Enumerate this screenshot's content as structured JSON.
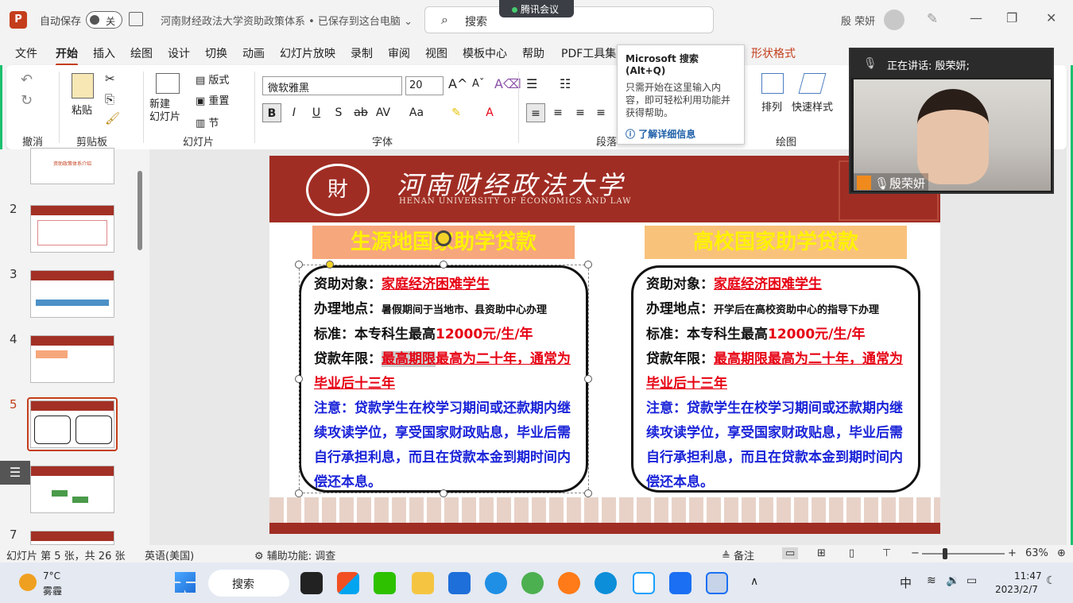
{
  "titlebar": {
    "autosave_label": "自动保存",
    "autosave_state": "关",
    "doc_title": "河南财经政法大学资助政策体系 • 已保存到这台电脑 ⌄",
    "search_label": "搜索",
    "meeting_pill": "腾讯会议",
    "user_name": "殷 荣妍"
  },
  "menu": [
    "文件",
    "开始",
    "插入",
    "绘图",
    "设计",
    "切换",
    "动画",
    "幻灯片放映",
    "录制",
    "审阅",
    "视图",
    "模板中心",
    "帮助",
    "PDF工具集"
  ],
  "menu_shape_format": "形状格式",
  "ribbon": {
    "undo_group": "撤消",
    "paste_label": "粘贴",
    "clipboard_group": "剪贴板",
    "new_slide_label": "新建\n幻灯片",
    "layout_label": "版式",
    "reset_label": "重置",
    "section_label": "节",
    "slides_group": "幻灯片",
    "font_name": "微软雅黑",
    "font_size": "20",
    "font_group": "字体",
    "paragraph_group": "段落",
    "arrange_label": "排列",
    "quick_styles_label": "快速样式",
    "drawing_group": "绘图"
  },
  "tooltip": {
    "title": "Microsoft 搜索(Alt+Q)",
    "body": "只需开始在这里输入内容，即可轻松利用功能并获得帮助。",
    "link": "了解详细信息"
  },
  "slide_panel": {
    "thumb1_title": "资助政策体系介绍",
    "numbers": [
      "2",
      "3",
      "4",
      "5",
      "6",
      "7"
    ]
  },
  "slide": {
    "univ_cn": "河南财经政法大学",
    "univ_en": "HENAN UNIVERSITY OF ECONOMICS AND LAW",
    "seal_text": "財",
    "left": {
      "title": "生源地国家助学贷款",
      "l1_label": "资助对象：",
      "l1_value": "家庭经济困难学生",
      "l2_label": "办理地点：",
      "l2_value": "暑假期间于当地市、县资助中心办理",
      "l3_label": "标准：本专科生最高",
      "l3_value": "12000元/生/年",
      "l4_label": "贷款年限：",
      "l4_value_a": "最高期限",
      "l4_value_b": "最高为二十年，通常为毕业后十三年",
      "note": "注意：贷款学生在校学习期间或还款期内继续攻读学位，享受国家财政贴息，毕业后需自行承担利息，而且在贷款本金到期时间内偿还本息。"
    },
    "right": {
      "title": "高校国家助学贷款",
      "l1_label": "资助对象：",
      "l1_value": "家庭经济困难学生",
      "l2_label": "办理地点：",
      "l2_value": "开学后在高校资助中心的指导下办理",
      "l3_label": "标准：本专科生最高",
      "l3_value": "12000元/生/年",
      "l4_label": "贷款年限：",
      "l4_value": "最高期限最高为二十年，通常为毕业后十三年",
      "note": "注意：贷款学生在校学习期间或还款期内继续攻读学位，享受国家财政贴息，毕业后需自行承担利息，而且在贷款本金到期时间内偿还本息。"
    }
  },
  "meeting": {
    "speaking": "正在讲话: 殷荣妍;",
    "speaker": "殷荣妍"
  },
  "statusbar": {
    "slide_info": "幻灯片 第 5 张，共 26 张",
    "language": "英语(美国)",
    "accessibility": "辅助功能: 调查",
    "notes": "备注",
    "zoom": "63%"
  },
  "taskbar": {
    "temp": "7°C",
    "weather": "雾霾",
    "search": "搜索",
    "ime": "中",
    "time": "11:47",
    "date": "2023/2/7"
  },
  "colors": {
    "accent": "#c43e1c",
    "slide_red": "#a02d24",
    "red_text": "#e60012",
    "blue_text": "#1a23d8",
    "title_yellow": "#fff200"
  }
}
